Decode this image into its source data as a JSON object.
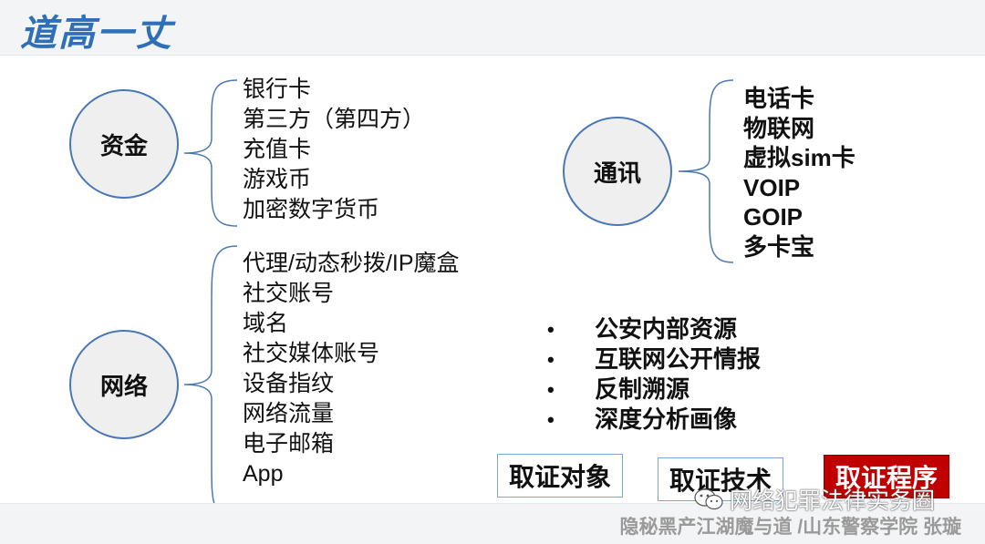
{
  "slide": {
    "title": "道高一丈",
    "funds": {
      "label": "资金",
      "items": [
        "银行卡",
        "第三方（第四方）",
        "充值卡",
        "游戏币",
        "加密数字货币"
      ]
    },
    "comm": {
      "label": "通讯",
      "items": [
        "电话卡",
        "物联网",
        "虚拟sim卡",
        "VOIP",
        "GOIP",
        "多卡宝"
      ]
    },
    "network": {
      "label": "网络",
      "items": [
        "代理/动态秒拨/IP魔盒",
        "社交账号",
        "域名",
        "社交媒体账号",
        "设备指纹",
        "网络流量",
        "电子邮箱",
        "App",
        "…"
      ]
    },
    "sources": {
      "bullet": "•",
      "items": [
        "公安内部资源",
        "互联网公开情报",
        "反制溯源",
        "深度分析画像"
      ]
    },
    "buttons": {
      "object": "取证对象",
      "technique": "取证技术",
      "procedure": "取证程序"
    },
    "footer": {
      "author": "隐秘黑产江湖魔与道 /山东警察学院 张璇",
      "watermark": "网络犯罪法律实务圈"
    }
  },
  "colors": {
    "title": "#2e6fb7",
    "circle_border": "#4a78b4",
    "brace": "#4a78b4",
    "red_box": "#c00000"
  }
}
